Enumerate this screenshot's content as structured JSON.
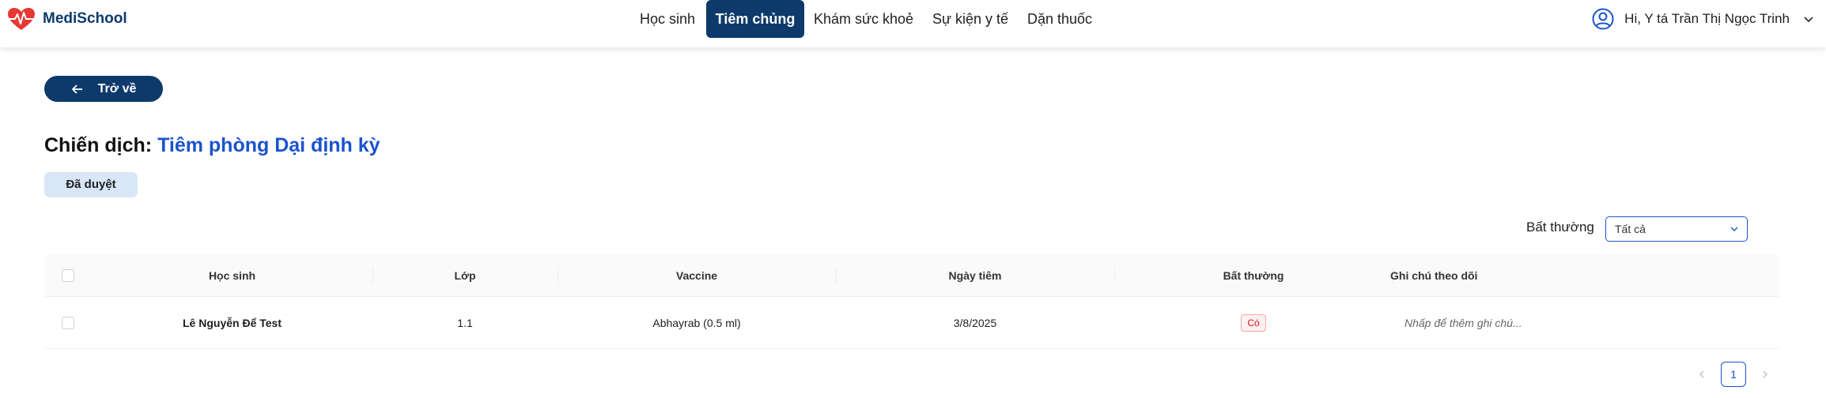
{
  "brand": {
    "name": "MediSchool",
    "accent": "#0d3a6b",
    "logo_color": "#e53935"
  },
  "nav": {
    "items": [
      {
        "label": "Học sinh",
        "active": false
      },
      {
        "label": "Tiêm chủng",
        "active": true
      },
      {
        "label": "Khám sức khoẻ",
        "active": false
      },
      {
        "label": "Sự kiện y tế",
        "active": false
      },
      {
        "label": "Dặn thuốc",
        "active": false
      }
    ]
  },
  "user": {
    "greeting": "Hi, Y tá Trần Thị Ngọc Trinh",
    "icon": "user-circle-icon"
  },
  "back_button": {
    "label": "Trở về",
    "icon": "arrow-left-icon"
  },
  "campaign": {
    "prefix": "Chiến dịch:",
    "name": "Tiêm phòng Dại định kỳ",
    "status": "Đã duyệt"
  },
  "filter": {
    "label": "Bất thường",
    "selected": "Tất cả"
  },
  "table": {
    "columns": [
      "Học sinh",
      "Lớp",
      "Vaccine",
      "Ngày tiêm",
      "Bất thường",
      "Ghi chú theo dõi"
    ],
    "rows": [
      {
        "student": "Lê Nguyễn Để Test",
        "class": "1.1",
        "vaccine": "Abhayrab (0.5 ml)",
        "date": "3/8/2025",
        "abnormal": "Có",
        "note_placeholder": "Nhấp để thêm ghi chú..."
      }
    ]
  },
  "pagination": {
    "current_page": "1"
  },
  "colors": {
    "primary": "#0d3a6b",
    "link": "#1a53cf",
    "tag_bg": "#d8e6f7",
    "danger": "#cf1322"
  }
}
